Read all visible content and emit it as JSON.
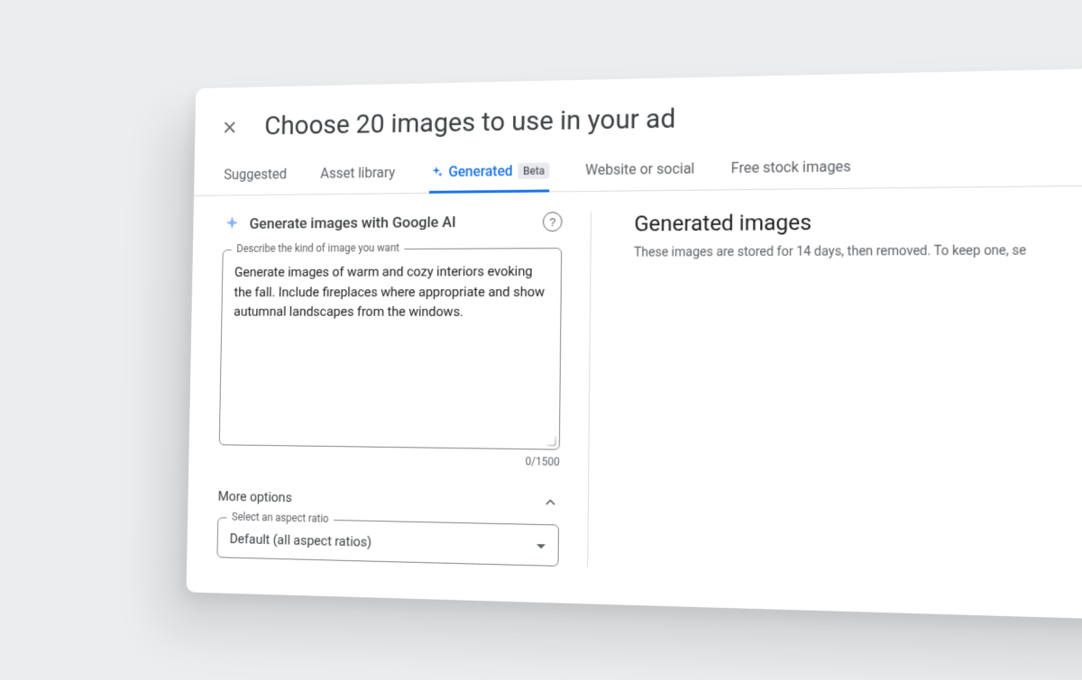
{
  "dialog": {
    "title": "Choose 20 images to use in your ad"
  },
  "tabs": {
    "suggested": "Suggested",
    "asset_library": "Asset library",
    "generated": "Generated",
    "beta_badge": "Beta",
    "website_social": "Website or social",
    "free_stock": "Free stock images"
  },
  "generator": {
    "heading": "Generate images with Google AI",
    "help_symbol": "?",
    "prompt_label": "Describe the kind of image you want",
    "prompt_value": "Generate images of warm and cozy interiors evoking the fall. Include fireplaces where appropriate and show autumnal landscapes from the windows.",
    "char_counter": "0/1500",
    "more_options_label": "More options",
    "aspect_ratio": {
      "label": "Select an aspect ratio",
      "value": "Default (all aspect ratios)"
    }
  },
  "results": {
    "heading": "Generated images",
    "storage_note": "These images are stored for 14 days, then removed. To keep one, se"
  },
  "colors": {
    "accent": "#1a73e8",
    "text_primary": "#202124",
    "text_secondary": "#5f6368",
    "border": "#dadce0"
  }
}
